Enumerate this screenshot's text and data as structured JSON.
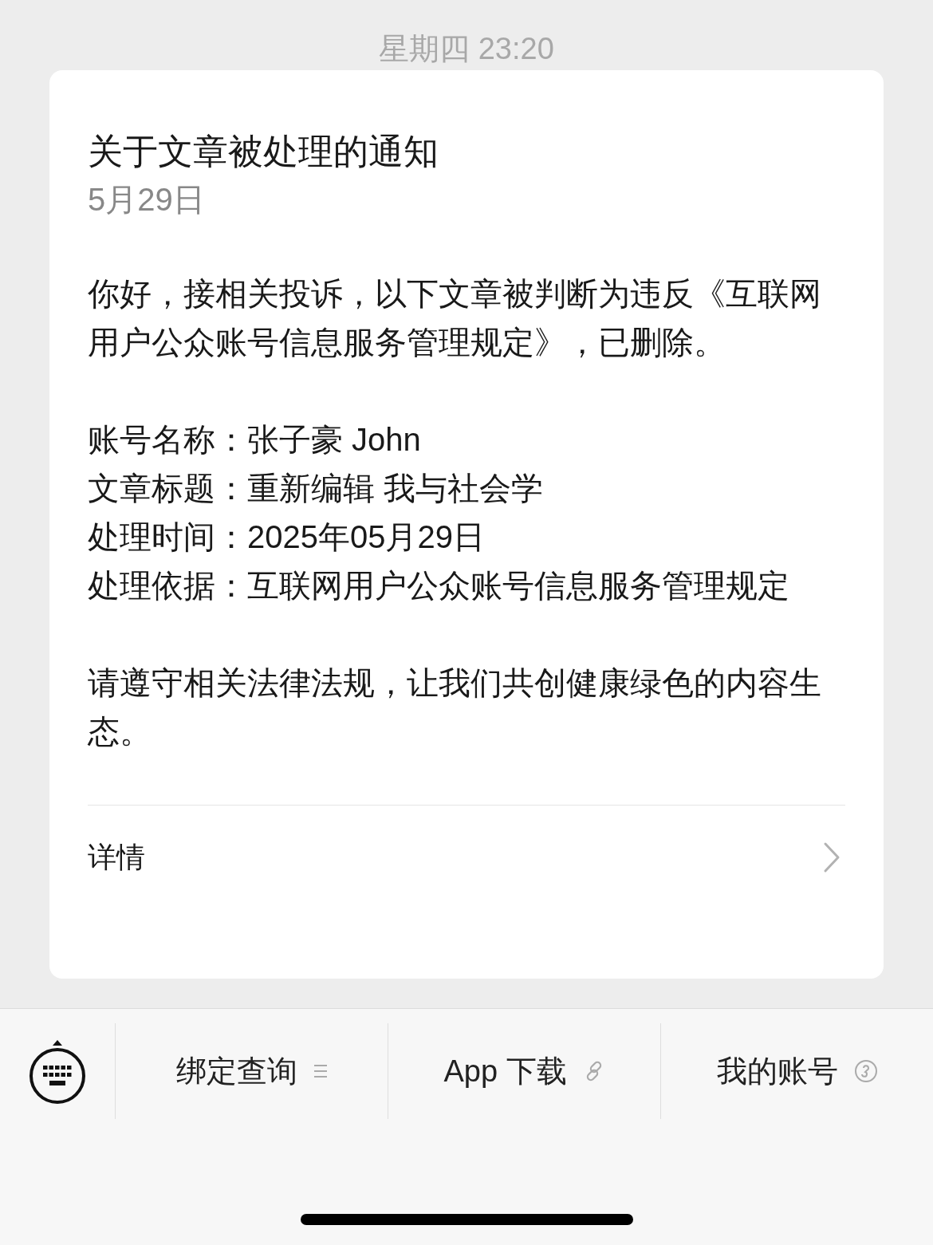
{
  "timestamp": "星期四 23:20",
  "card": {
    "title": "关于文章被处理的通知",
    "date": "5月29日",
    "sections": [
      [
        "你好，接相关投诉，以下文章被判断为违反《互联网用户公众账号信息服务管理规定》，已删除。"
      ],
      [
        "账号名称：张子豪 John",
        "文章标题：重新编辑 我与社会学",
        "处理时间：2025年05月29日",
        "处理依据：互联网用户公众账号信息服务管理规定"
      ],
      [
        "请遵守相关法律法规，让我们共创健康绿色的内容生态。"
      ]
    ],
    "details_link": "详情"
  },
  "menu": [
    {
      "label": "绑定查询",
      "kind": "submenu"
    },
    {
      "label": "App 下载",
      "kind": "link"
    },
    {
      "label": "我的账号",
      "kind": "miniprogram"
    }
  ]
}
